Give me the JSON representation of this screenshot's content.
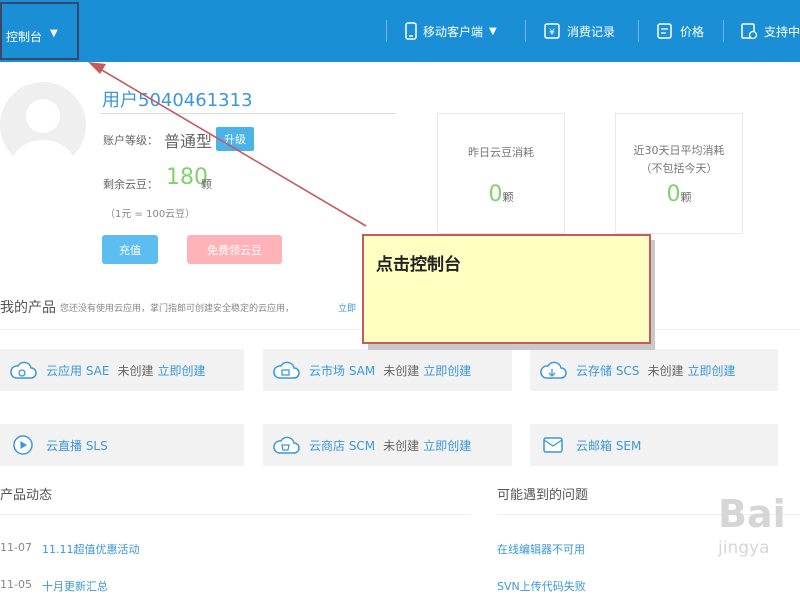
{
  "topbar": {
    "console_label": "控制台",
    "mobile_client": "移动客户端",
    "consumption_record": "消费记录",
    "price": "价格",
    "support": "支持中"
  },
  "profile": {
    "username": "用户5040461313",
    "level_label": "账户等级：",
    "level_value": "普通型",
    "upgrade": "升级",
    "beans_label": "剩余云豆：",
    "beans_value": "180",
    "beans_unit": "颗",
    "rate_note": "（1元 = 100云豆）",
    "recharge": "充值",
    "free_beans": "免费领云豆"
  },
  "stats": [
    {
      "title": "昨日云豆消耗",
      "subtitle": "",
      "value": "0",
      "unit": "颗"
    },
    {
      "title": "近30天日平均消耗",
      "subtitle": "（不包括今天）",
      "value": "0",
      "unit": "颗"
    }
  ],
  "products": {
    "title": "我的产品",
    "note": "您还没有使用云应用，掌门指郎可创建安全稳定的云应用，",
    "link": "立即",
    "items": [
      {
        "name": "云应用 SAE",
        "status": "未创建",
        "link": "立即创建",
        "icon": "cloud-app-icon"
      },
      {
        "name": "云市场 SAM",
        "status": "未创建",
        "link": "立即创建",
        "icon": "cloud-market-icon"
      },
      {
        "name": "云存储 SCS",
        "status": "未创建",
        "link": "立即创建",
        "icon": "cloud-storage-icon"
      },
      {
        "name": "云直播 SLS",
        "status": "",
        "link": "",
        "icon": "cloud-live-icon"
      },
      {
        "name": "云商店 SCM",
        "status": "未创建",
        "link": "立即创建",
        "icon": "cloud-shop-icon"
      },
      {
        "name": "云邮箱 SEM",
        "status": "",
        "link": "",
        "icon": "cloud-mail-icon"
      }
    ]
  },
  "news": {
    "title": "产品动态",
    "items": [
      {
        "date": "11-07",
        "text": "11.11超值优惠活动"
      },
      {
        "date": "11-05",
        "text": "十月更新汇总"
      }
    ]
  },
  "faq": {
    "title": "可能遇到的问题",
    "items": [
      "在线编辑器不可用",
      "SVN上传代码失败"
    ]
  },
  "callout": {
    "text": "点击控制台"
  },
  "watermark": {
    "top": "Bai",
    "bottom": "jingya"
  },
  "colors": {
    "topbar": "#1b8fd6",
    "accent_blue": "#3b97d9",
    "bean_green": "#7fd36a",
    "callout_fill": "#ffffc2",
    "callout_border": "#c7595f",
    "arrow": "#c7595f",
    "highlight_box": "#3a4766"
  }
}
